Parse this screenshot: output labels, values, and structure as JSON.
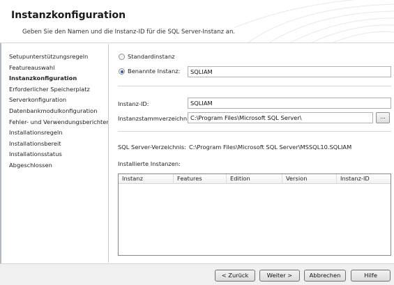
{
  "window": {
    "title": "Instanzkonfiguration",
    "subtitle": "Geben Sie den Namen und die Instanz-ID für die SQL Server-Instanz an."
  },
  "sidebar": {
    "items": [
      {
        "label": "Setupunterstützungsregeln",
        "active": false
      },
      {
        "label": "Featureauswahl",
        "active": false
      },
      {
        "label": "Instanzkonfiguration",
        "active": true
      },
      {
        "label": "Erforderlicher Speicherplatz",
        "active": false
      },
      {
        "label": "Serverkonfiguration",
        "active": false
      },
      {
        "label": "Datenbankmodulkonfiguration",
        "active": false
      },
      {
        "label": "Fehler- und Verwendungsberichter...",
        "active": false
      },
      {
        "label": "Installationsregeln",
        "active": false
      },
      {
        "label": "Installationsbereit",
        "active": false
      },
      {
        "label": "Installationsstatus",
        "active": false
      },
      {
        "label": "Abgeschlossen",
        "active": false
      }
    ]
  },
  "instance": {
    "default_label": "Standardinstanz",
    "named_label": "Benannte Instanz:",
    "named_value": "SQLIAM",
    "selected": "named"
  },
  "instance_id": {
    "label": "Instanz-ID:",
    "value": "SQLIAM"
  },
  "root_dir": {
    "label": "Instanzstammverzeichnis:",
    "value": "C:\\Program Files\\Microsoft SQL Server\\",
    "browse_label": "..."
  },
  "sql_dir": {
    "label": "SQL Server-Verzeichnis:",
    "value": "C:\\Program Files\\Microsoft SQL Server\\MSSQL10.SQLIAM"
  },
  "installed": {
    "label": "Installierte Instanzen:",
    "columns": [
      "Instanz",
      "Features",
      "Edition",
      "Version",
      "Instanz-ID"
    ],
    "rows": []
  },
  "footer": {
    "back": "< Zurück",
    "next": "Weiter >",
    "cancel": "Abbrechen",
    "help": "Hilfe"
  }
}
